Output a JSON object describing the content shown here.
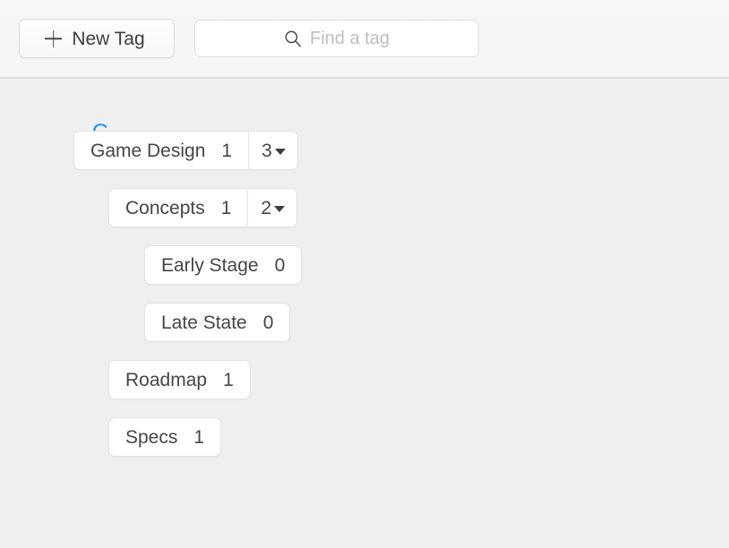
{
  "toolbar": {
    "new_tag_label": "New Tag",
    "new_tag_icon": "plus-icon",
    "search_placeholder": "Find a tag",
    "search_value": "",
    "search_icon": "search-icon"
  },
  "colors": {
    "accent": "#1b8ef2",
    "toolbar_background": "#f7f6f4",
    "body_background": "#efefef",
    "pill_background": "#ffffff",
    "pill_border": "#e2e2e2",
    "text": "#454545"
  },
  "sections": [
    {
      "letter": "G",
      "tags": [
        {
          "name": "Game Design",
          "count": "1",
          "indent": 82,
          "has_children": true,
          "children_count": "3",
          "chevron": "chevron-down-icon"
        },
        {
          "name": "Concepts",
          "count": "1",
          "indent": 121,
          "has_children": true,
          "children_count": "2",
          "chevron": "chevron-down-icon"
        },
        {
          "name": "Early Stage",
          "count": "0",
          "indent": 161,
          "has_children": false,
          "children_count": "",
          "chevron": ""
        },
        {
          "name": "Late State",
          "count": "0",
          "indent": 161,
          "has_children": false,
          "children_count": "",
          "chevron": ""
        },
        {
          "name": "Roadmap",
          "count": "1",
          "indent": 121,
          "has_children": false,
          "children_count": "",
          "chevron": ""
        },
        {
          "name": "Specs",
          "count": "1",
          "indent": 121,
          "has_children": false,
          "children_count": "",
          "chevron": ""
        }
      ]
    }
  ]
}
